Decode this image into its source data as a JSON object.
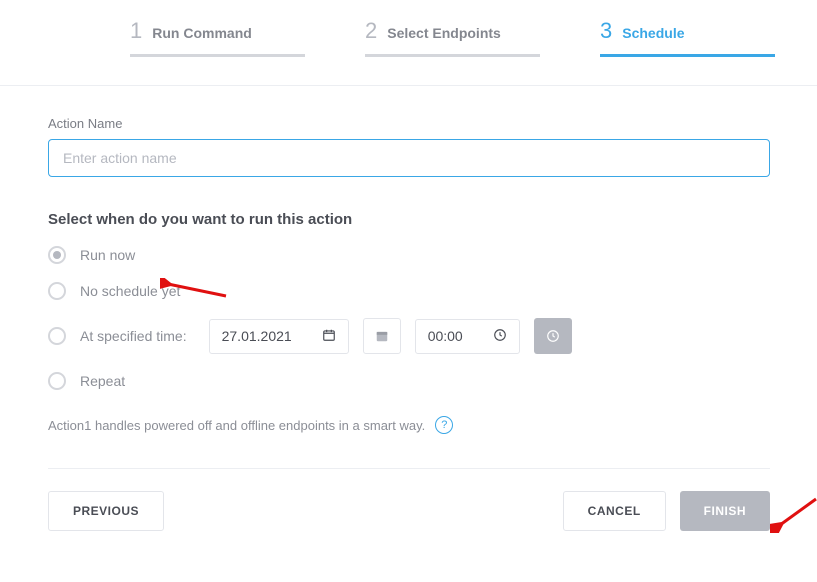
{
  "stepper": {
    "steps": [
      {
        "num": "1",
        "label": "Run Command"
      },
      {
        "num": "2",
        "label": "Select Endpoints"
      },
      {
        "num": "3",
        "label": "Schedule"
      }
    ]
  },
  "action_name": {
    "label": "Action Name",
    "placeholder": "Enter action name",
    "value": ""
  },
  "schedule": {
    "title": "Select when do you want to run this action",
    "options": {
      "run_now": "Run now",
      "no_schedule": "No schedule yet",
      "at_time": "At specified time:",
      "repeat": "Repeat"
    },
    "selected": "run_now",
    "date": "27.01.2021",
    "time": "00:00"
  },
  "hint": {
    "text": "Action1 handles powered off and offline endpoints in a smart way.",
    "help": "?"
  },
  "buttons": {
    "previous": "PREVIOUS",
    "cancel": "CANCEL",
    "finish": "FINISH"
  }
}
